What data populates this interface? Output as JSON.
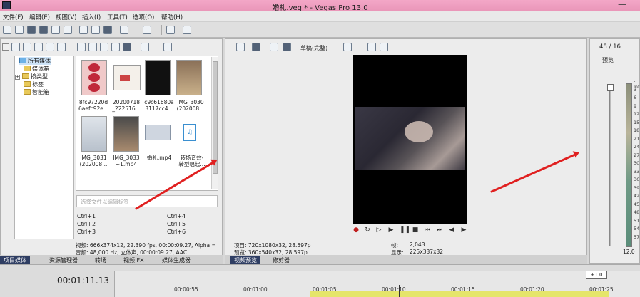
{
  "window": {
    "title": "婚礼.veg * - Vegas Pro 13.0",
    "minimize": "—"
  },
  "menu": [
    "文件(F)",
    "编辑(E)",
    "视图(V)",
    "插入(I)",
    "工具(T)",
    "选项(O)",
    "帮助(H)"
  ],
  "explorer": {
    "tree": [
      "所有媒体",
      "媒体箱",
      "按类型",
      "标签",
      "智能箱"
    ],
    "tag_placeholder": "选择文件以编辑标签",
    "hotkeys": [
      "Ctrl+1",
      "Ctrl+2",
      "Ctrl+3",
      "Ctrl+4",
      "Ctrl+5",
      "Ctrl+6"
    ],
    "media": [
      {
        "name": "8fc97220d\n6aefc92e...",
        "color": "#f0c9c9"
      },
      {
        "name": "20200718\n_222516...",
        "color": "#f4f0ea"
      },
      {
        "name": "c9c61680a\n3117cc4...",
        "color": "#111111"
      },
      {
        "name": "IMG_3030\n(202008...",
        "color": "#b89d80"
      },
      {
        "name": "IMG_3031\n(202008...",
        "color": "#d9dde2"
      },
      {
        "name": "IMG_3033\n~1.mp4",
        "color": "#a88a6e"
      },
      {
        "name": "婚礼.mp4",
        "color": "#cfd6e0"
      },
      {
        "name": "转场音效-\n转型唱起...",
        "color": "#ffffff"
      }
    ],
    "video_info": "视频: 666x374x12, 22.390 fps, 00:00:09.27, Alpha =",
    "audio_info": "音频: 48,000 Hz, 立体声, 00:00:09.27, AAC",
    "tabs": [
      "项目媒体",
      "资源管理器",
      "转场",
      "视频 FX",
      "媒体生成器"
    ]
  },
  "preview": {
    "quality": "草稿(完整)",
    "project_label": "项目: 720x1080x32, 28.597p",
    "preview_label": "预览: 360x540x32, 28.597p",
    "frame_label": "帧:",
    "frame_value": "2,043",
    "display_label": "显示:",
    "display_value": "225x337x32",
    "tabs": [
      "视频预览",
      "修剪器"
    ]
  },
  "master": {
    "counter": "48 / 16",
    "label": "预览",
    "scale": [
      "-Inf",
      "3",
      "6",
      "9",
      "12",
      "15",
      "18",
      "21",
      "24",
      "27",
      "30",
      "33",
      "36",
      "39",
      "42",
      "45",
      "48",
      "51",
      "54",
      "57"
    ],
    "level": "12.0"
  },
  "timeline": {
    "timecode": "00:01:11.13",
    "rate": "+1.0",
    "ticks": [
      "00:00:55",
      "00:01:00",
      "00:01:05",
      "00:01:10",
      "00:01:15",
      "00:01:20",
      "00:01:25"
    ]
  }
}
